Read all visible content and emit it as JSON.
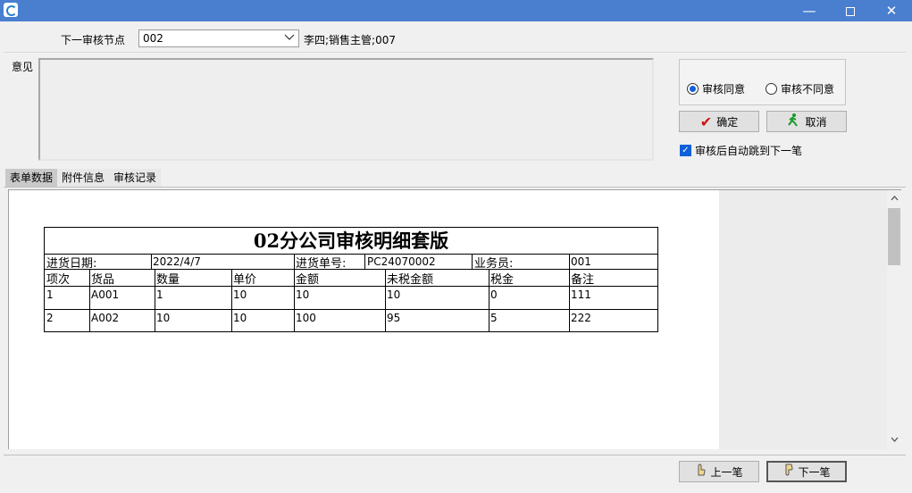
{
  "window": {
    "minimize": "—",
    "close": "✕"
  },
  "next_node": {
    "label": "下一审核节点",
    "value": "002",
    "approver": "李四;销售主管;007"
  },
  "opinion": {
    "label": "意见",
    "text": ""
  },
  "decision": {
    "agree_label": "审核同意",
    "disagree_label": "审核不同意",
    "selected": "agree"
  },
  "buttons": {
    "ok": "确定",
    "cancel": "取消",
    "prev": "上一笔",
    "next": "下一笔"
  },
  "auto_next": {
    "label": "审核后自动跳到下一笔",
    "checked": true
  },
  "tabs": [
    {
      "label": "表单数据",
      "active": true
    },
    {
      "label": "附件信息",
      "active": false
    },
    {
      "label": "审核记录",
      "active": false
    }
  ],
  "report": {
    "title": "02分公司审核明细套版",
    "date_label": "进货日期:",
    "date_value": "2022/4/7",
    "order_label": "进货单号:",
    "order_value": "PC24070002",
    "salesman_label": "业务员:",
    "salesman_value": "001",
    "columns": [
      "项次",
      "货品",
      "数量",
      "单价",
      "金额",
      "未税金额",
      "税金",
      "备注"
    ],
    "rows": [
      [
        "1",
        "A001",
        "1",
        "10",
        "10",
        "10",
        "0",
        "111"
      ],
      [
        "2",
        "A002",
        "10",
        "10",
        "100",
        "95",
        "5",
        "222"
      ]
    ]
  }
}
